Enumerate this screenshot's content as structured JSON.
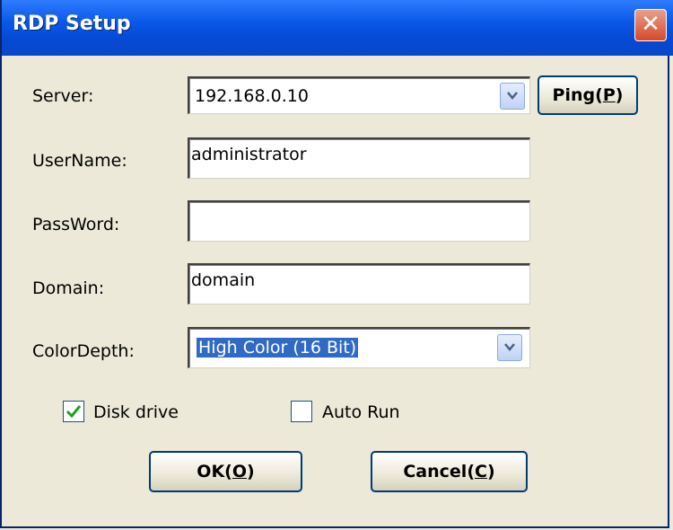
{
  "window": {
    "title": "RDP Setup",
    "close_glyph": "✕"
  },
  "server": {
    "label": "Server:",
    "value": "192.168.0.10"
  },
  "ping_button": {
    "label": "Ping",
    "accel": "P"
  },
  "username": {
    "label": "UserName:",
    "value": "administrator"
  },
  "password": {
    "label": "PassWord:",
    "value": ""
  },
  "domain": {
    "label": "Domain:",
    "value": "domain"
  },
  "color_depth": {
    "label": "ColorDepth:",
    "value": "High Color (16 Bit)"
  },
  "disk_drive": {
    "label": "Disk drive",
    "checked": true
  },
  "auto_run": {
    "label": "Auto Run",
    "checked": false
  },
  "ok_button": {
    "label": "OK",
    "accel": "O"
  },
  "cancel_button": {
    "label": "Cancel",
    "accel": "C"
  },
  "colors": {
    "titlebar": "#0A58E8",
    "background": "#ECE9D8",
    "selection": "#316AC5",
    "close": "#D7482A",
    "check": "#21A121"
  }
}
